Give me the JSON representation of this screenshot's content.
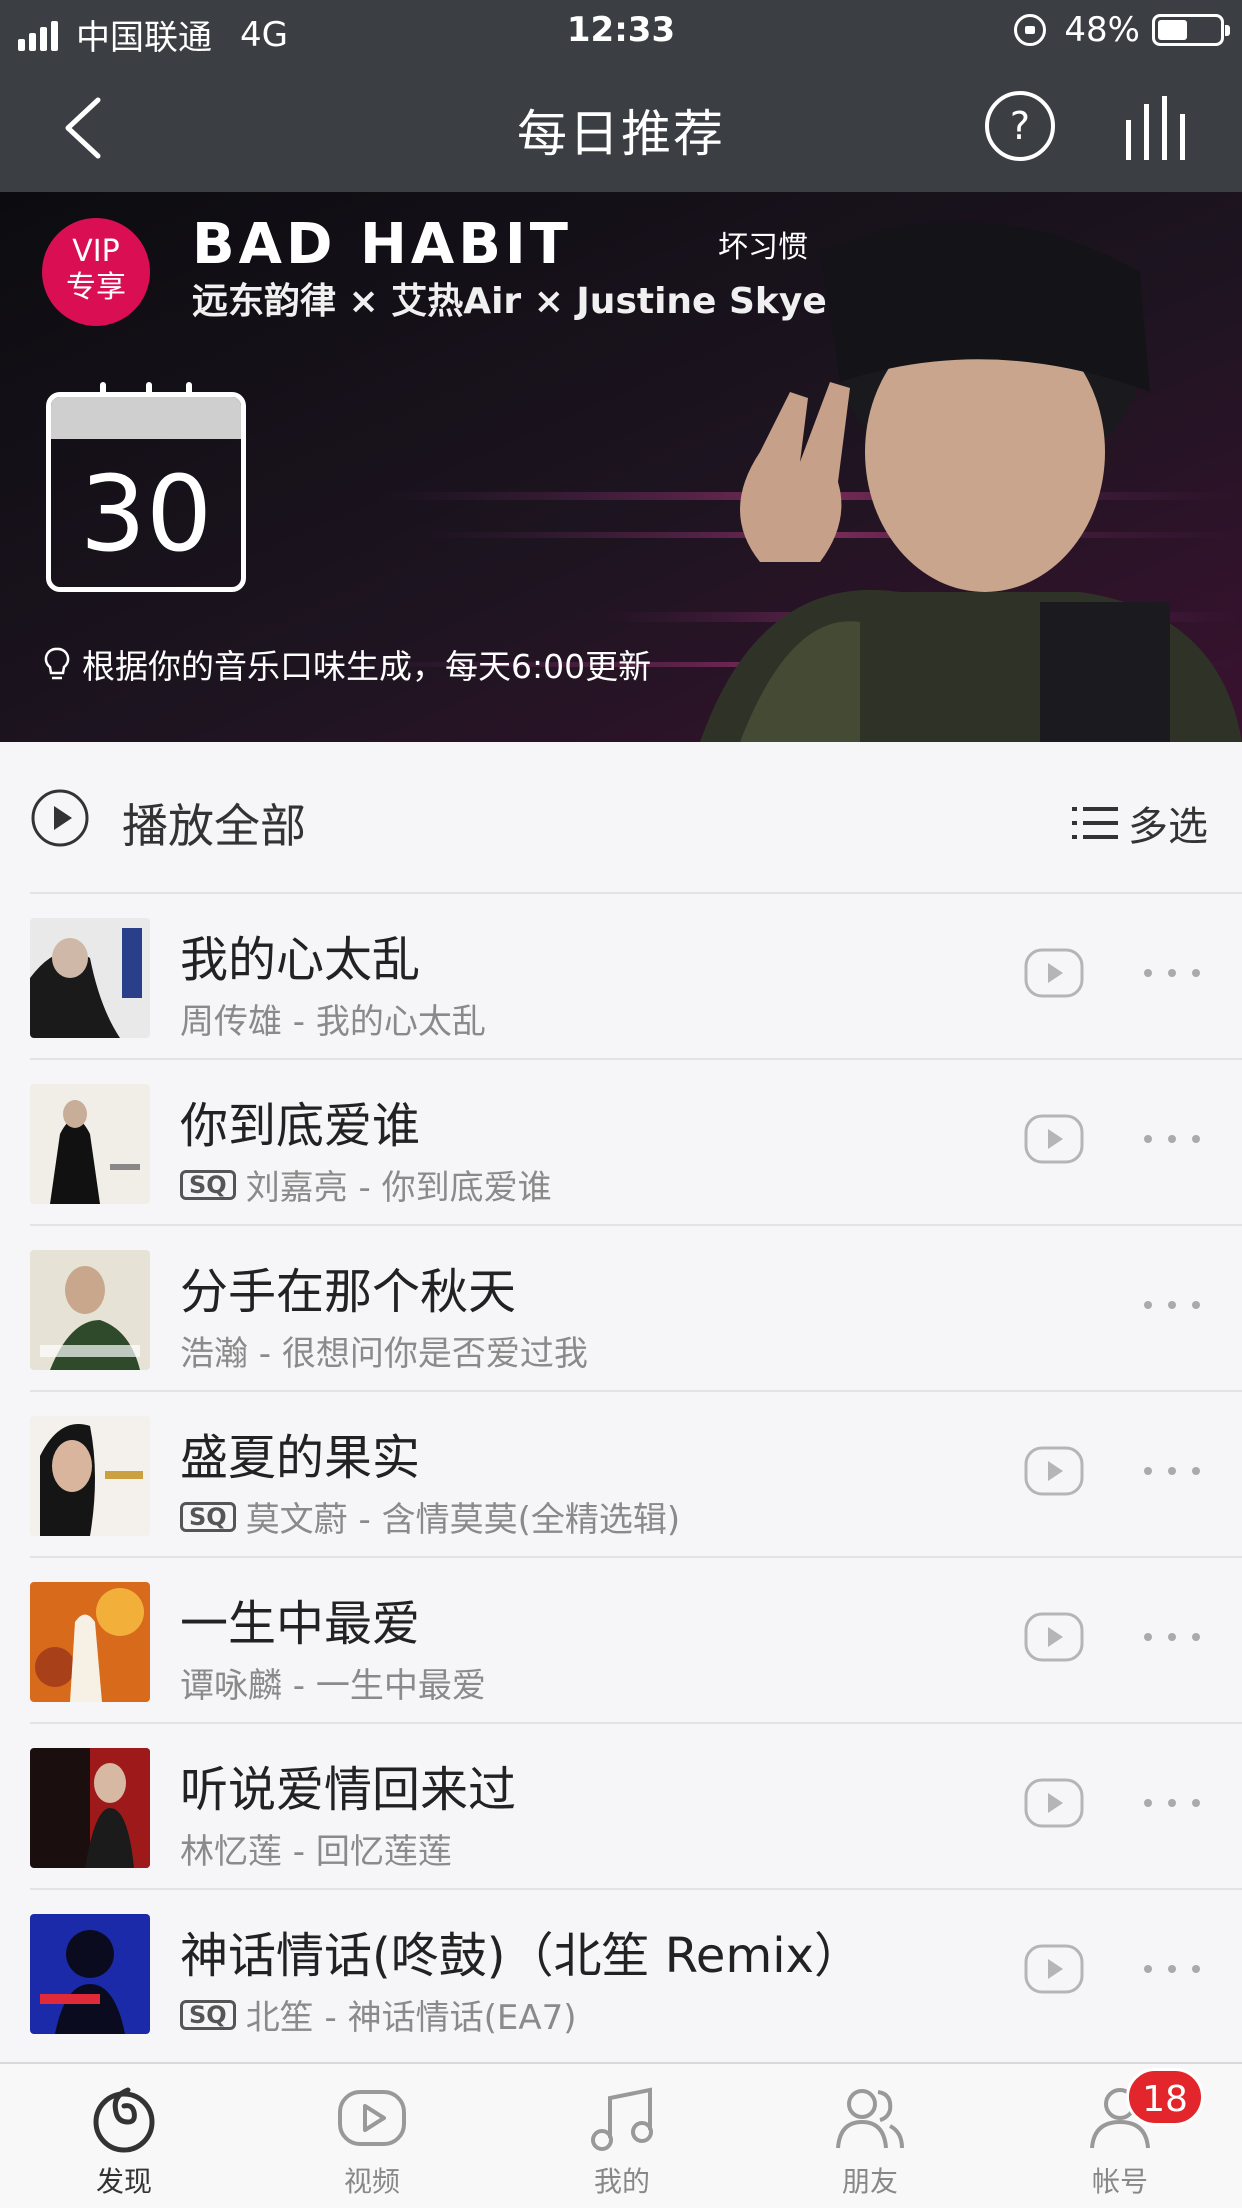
{
  "status_bar": {
    "carrier": "中国联通",
    "network": "4G",
    "time": "12:33",
    "battery": "48%",
    "battery_level": 0.48
  },
  "nav": {
    "title": "每日推荐",
    "back_icon": "back-arrow-icon",
    "help_icon": "help-icon",
    "playing_icon": "equalizer-icon"
  },
  "banner": {
    "vip_line1": "VIP",
    "vip_line2": "专享",
    "promo_title": "BAD HABIT",
    "promo_title_cn": "坏习惯",
    "promo_artists": "远东韵律 × 艾热Air × Justine Skye",
    "calendar_day": "30",
    "hint": "根据你的音乐口味生成，每天6:00更新"
  },
  "list_header": {
    "play_all": "播放全部",
    "multi_select": "多选"
  },
  "songs": [
    {
      "title": "我的心太乱",
      "sq": "",
      "subtitle": "周传雄 - 我的心太乱",
      "has_mv": true
    },
    {
      "title": "你到底爱谁",
      "sq": "SQ",
      "subtitle": "刘嘉亮 - 你到底爱谁",
      "has_mv": true
    },
    {
      "title": "分手在那个秋天",
      "sq": "",
      "subtitle": "浩瀚 - 很想问你是否爱过我",
      "has_mv": false
    },
    {
      "title": "盛夏的果实",
      "sq": "SQ",
      "subtitle": "莫文蔚 - 含情莫莫(全精选辑)",
      "has_mv": true
    },
    {
      "title": "一生中最爱",
      "sq": "",
      "subtitle": "谭咏麟 - 一生中最爱",
      "has_mv": true
    },
    {
      "title": "听说爱情回来过",
      "sq": "",
      "subtitle": "林忆莲 - 回忆莲莲",
      "has_mv": true
    },
    {
      "title": "神话情话(咚鼓)（北笙 Remix）",
      "sq": "SQ",
      "subtitle": "北笙 - 神话情话(EA7)",
      "has_mv": true
    }
  ],
  "tabs": [
    {
      "label": "发现",
      "icon": "netease-logo-icon",
      "active": true
    },
    {
      "label": "视频",
      "icon": "video-play-icon",
      "active": false
    },
    {
      "label": "我的",
      "icon": "music-note-icon",
      "active": false
    },
    {
      "label": "朋友",
      "icon": "friends-icon",
      "active": false
    },
    {
      "label": "帐号",
      "icon": "account-icon",
      "active": false
    }
  ],
  "account_badge": "18",
  "colors": {
    "header_bg": "#3b3f43",
    "vip_red": "#d90e53",
    "badge_red": "#e3262b",
    "page_bg": "#f6f6f8"
  }
}
